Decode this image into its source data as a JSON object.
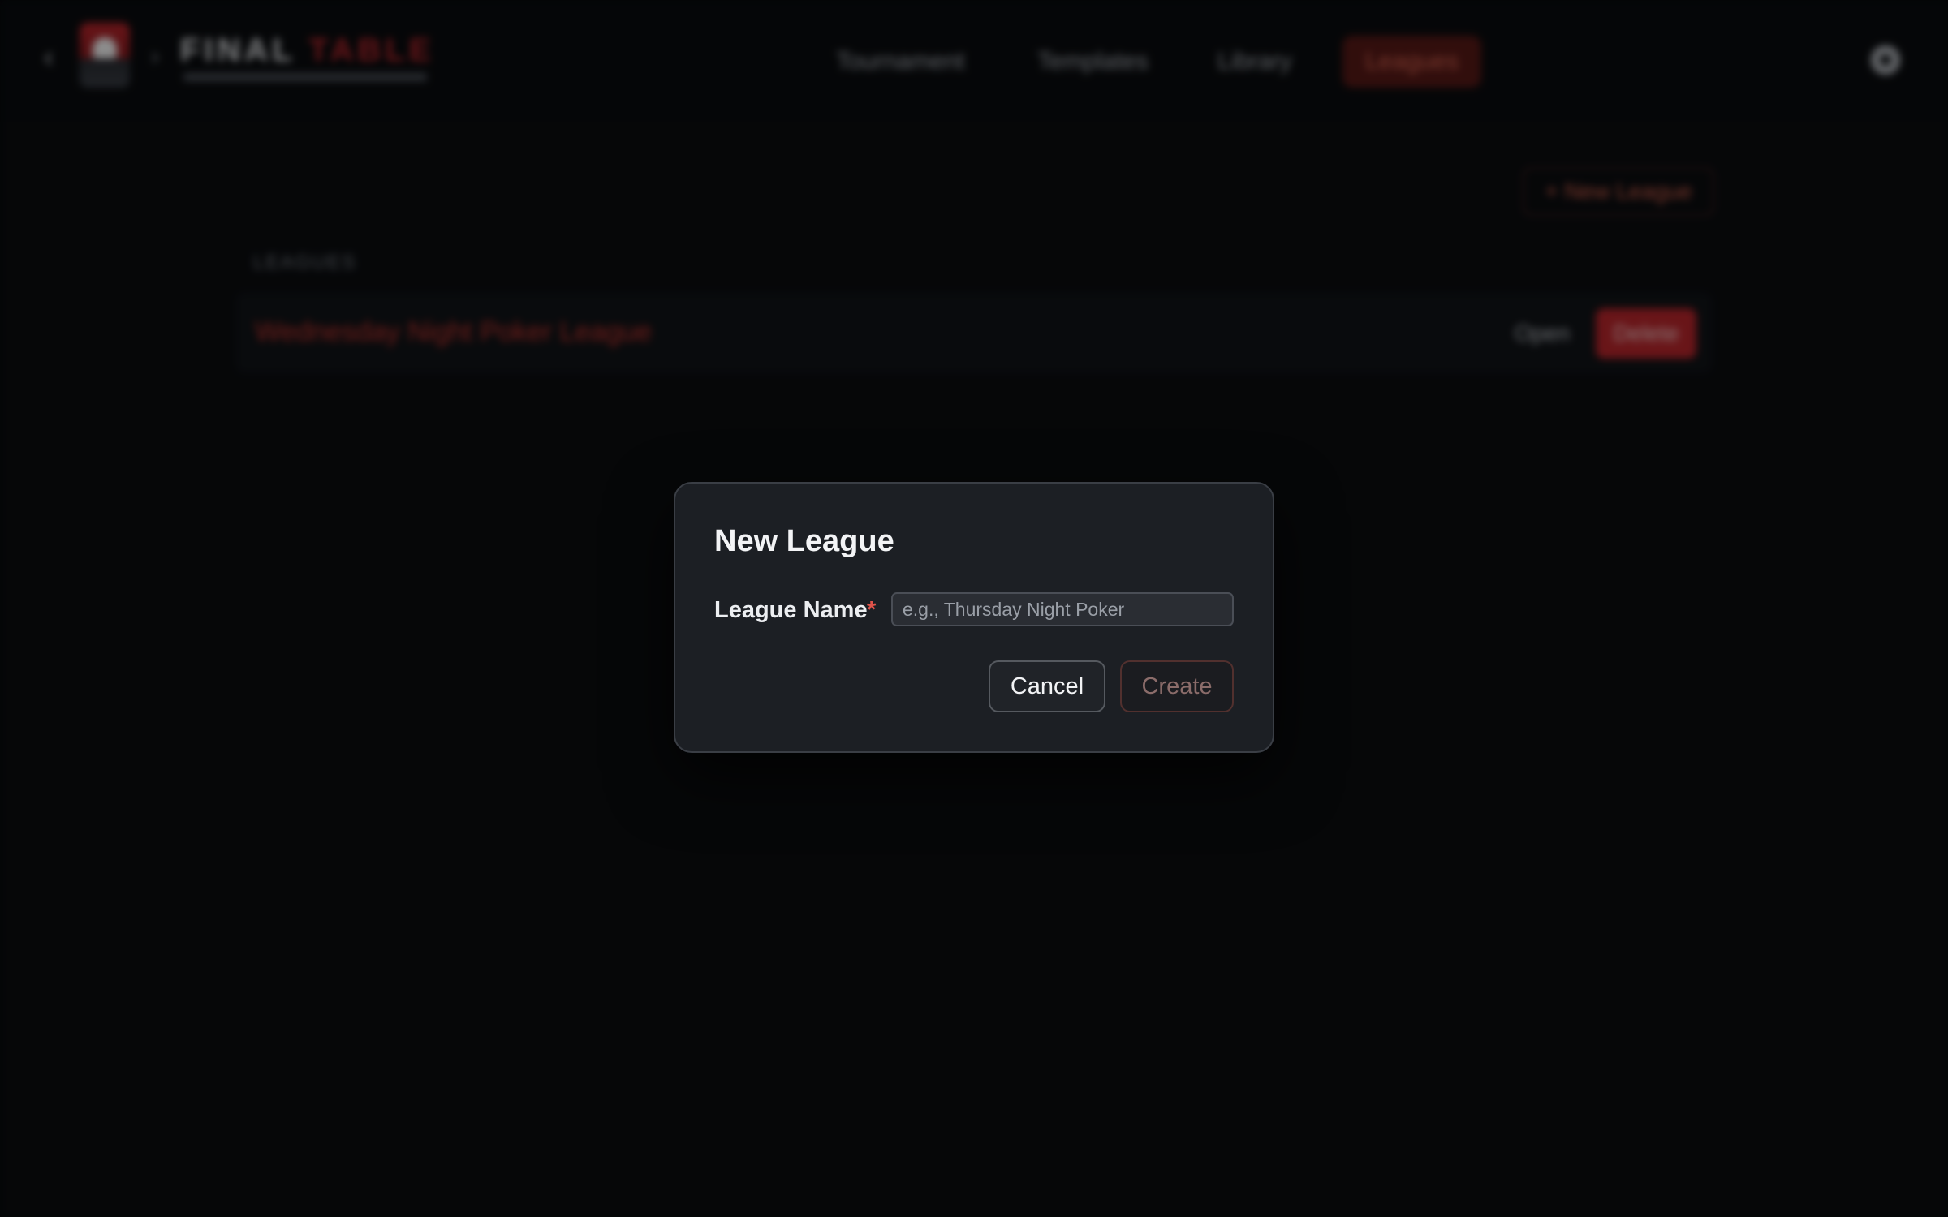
{
  "app": {
    "logo": {
      "word_main": "FINAL",
      "word_accent": "TABLE"
    },
    "nav": {
      "items": [
        {
          "label": "Tournament"
        },
        {
          "label": "Templates"
        },
        {
          "label": "Library"
        },
        {
          "label": "Leagues",
          "active": true
        }
      ]
    },
    "new_league_label": "+ New League",
    "section_label": "LEAGUES",
    "leagues": [
      {
        "name": "Wednesday Night Poker League",
        "open_label": "Open",
        "delete_label": "Delete"
      }
    ]
  },
  "modal": {
    "title": "New League",
    "field_label": "League Name",
    "required_mark": "*",
    "input_value": "",
    "input_placeholder": "e.g., Thursday Night Poker",
    "cancel_label": "Cancel",
    "create_label": "Create"
  },
  "colors": {
    "brand_red": "#c0272d",
    "modal_bg": "#1c1f24",
    "page_bg": "#0b0d10"
  },
  "icons": [
    "back-icon",
    "forward-icon",
    "logo-icon",
    "settings-icon"
  ]
}
